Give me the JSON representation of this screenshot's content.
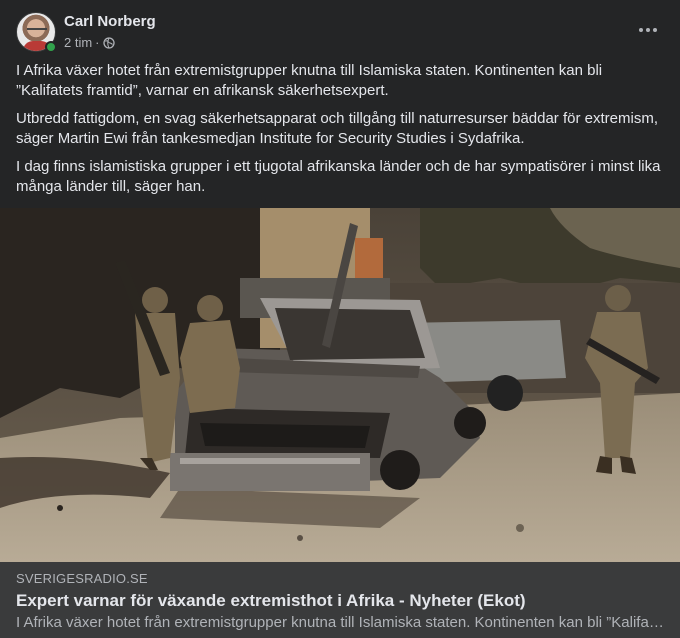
{
  "post": {
    "author": "Carl Norberg",
    "time": "2 tim",
    "separator": "·",
    "privacy_icon": "globe-icon",
    "paragraphs": [
      "I Afrika växer hotet från extremistgrupper knutna till Islamiska staten. Kontinenten kan bli ”Kalifatets framtid”, varnar en afrikansk säkerhetsexpert.",
      "Utbredd fattigdom, en svag säkerhetsapparat och tillgång till naturresurser bäddar för extremism, säger Martin Ewi från tankesmedjan Institute for Security Studies i Sydafrika.",
      "I dag finns islamistiska grupper i ett tjugotal afrikanska länder och de har sympatisörer i minst lika många länder till, säger han."
    ]
  },
  "link": {
    "domain": "SVERIGESRADIO.SE",
    "title": "Expert varnar för växande extremisthot i Afrika - Nyheter (Ekot)",
    "description": "I Afrika växer hotet från extremistgrupper knutna till Islamiska staten. Kontinenten kan bli ”Kalifatets framtid”, varnar en afrikansk säkerhetsexpert."
  },
  "colors": {
    "card_bg": "#242526",
    "preview_bg": "#3a3b3c",
    "text_primary": "#e4e6eb",
    "text_secondary": "#b0b3b8",
    "online": "#31a24c"
  }
}
